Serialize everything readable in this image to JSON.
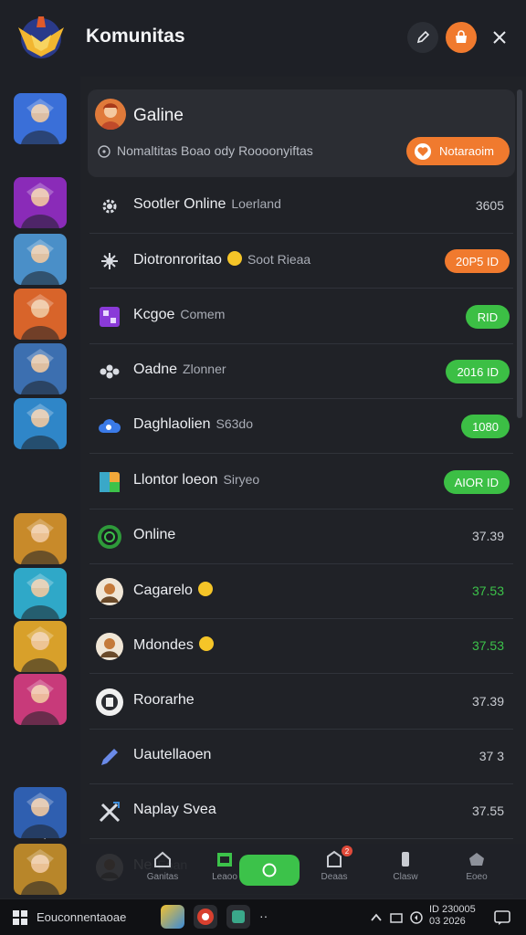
{
  "app": {
    "title": "Komunitas"
  },
  "colors": {
    "accent_orange": "#f07a2e",
    "accent_green": "#3cc24a",
    "background": "#1b1d22"
  },
  "sidebar": {
    "games": [
      {
        "name": "game-tile-1",
        "tint": "#3a6fd8"
      },
      {
        "name": "game-tile-2",
        "tint": "#8a2bb8"
      },
      {
        "name": "game-tile-3",
        "tint": "#4a8fc8"
      },
      {
        "name": "game-tile-4",
        "tint": "#d8642a"
      },
      {
        "name": "game-tile-5",
        "tint": "#3c6fb0"
      },
      {
        "name": "game-tile-6",
        "tint": "#2f86c8"
      },
      {
        "name": "game-tile-7",
        "tint": "#c88a2a"
      },
      {
        "name": "game-tile-8",
        "tint": "#2fa8c8"
      },
      {
        "name": "game-tile-9",
        "tint": "#d8a02a"
      },
      {
        "name": "game-tile-10",
        "tint": "#c83a7a"
      },
      {
        "name": "game-tile-11",
        "tint": "#2f5fb0"
      },
      {
        "name": "game-tile-12",
        "tint": "#b8862a"
      }
    ]
  },
  "featured": {
    "name": "Galine",
    "description": "Nomaltitas Boao ody Roooonyiftas",
    "button_label": "Notaraoim"
  },
  "rows": [
    {
      "icon": "gear-icon",
      "title": "Sootler Online",
      "sub": "Loerland",
      "value": "3605",
      "value_style": "plain"
    },
    {
      "icon": "spark-icon",
      "title": "Diotronroritao",
      "emoji": true,
      "sub": "Soot Rieaa",
      "badge": "20P5 ID",
      "badge_style": "orange"
    },
    {
      "icon": "grid-icon",
      "title": "Kcgoe",
      "sub": "Comem",
      "badge": "RID",
      "badge_style": "green"
    },
    {
      "icon": "dots-icon",
      "title": "Oadne",
      "sub": "Zlonner",
      "badge": "2016 ID",
      "badge_style": "green"
    },
    {
      "icon": "cloud-icon",
      "title": "Daghlaolien",
      "sub": "S63do",
      "badge": "1080",
      "badge_style": "green"
    },
    {
      "icon": "cube-icon",
      "title": "Llontor loeon",
      "sub": "Siryeo",
      "badge": "AIOR ID",
      "badge_style": "green"
    },
    {
      "icon": "globe-icon",
      "title": "Online",
      "value": "37.39",
      "value_style": "plain"
    },
    {
      "icon": "avatar-icon",
      "title": "Cagarelo",
      "emoji": true,
      "value": "37.53",
      "value_style": "green"
    },
    {
      "icon": "avatar-icon",
      "title": "Mdondes",
      "emoji": true,
      "value": "37.53",
      "value_style": "green"
    },
    {
      "icon": "badge-icon",
      "title": "Roorarhe",
      "value": "37.39",
      "value_style": "plain"
    },
    {
      "icon": "pen-icon",
      "title": "Uautellaoen",
      "value": "37 3",
      "value_style": "plain"
    },
    {
      "icon": "swords-icon",
      "title": "Naplay Svea",
      "value": "37.55",
      "value_style": "plain"
    },
    {
      "icon": "avatar-icon",
      "title": "Ne",
      "sub": "Eoan",
      "value": "",
      "value_style": "plain"
    }
  ],
  "bottom_nav": {
    "items": [
      {
        "name": "nav-home",
        "icon": "home-icon",
        "label": "Ganitas"
      },
      {
        "name": "nav-library",
        "icon": "library-icon",
        "label": "Leaoo"
      },
      {
        "name": "nav-community",
        "icon": "chat-icon",
        "label": ""
      },
      {
        "name": "nav-store",
        "icon": "store-icon",
        "label": "Deaas",
        "badge": "2"
      },
      {
        "name": "nav-alert",
        "icon": "alert-icon",
        "label": "Clasw"
      },
      {
        "name": "nav-profile",
        "icon": "profile-icon",
        "label": "Eoeo"
      }
    ]
  },
  "taskbar": {
    "search_label": "Eouconnentaoae",
    "more_label": "··",
    "clock_time": "ID 230005",
    "clock_date": "03 2026"
  }
}
